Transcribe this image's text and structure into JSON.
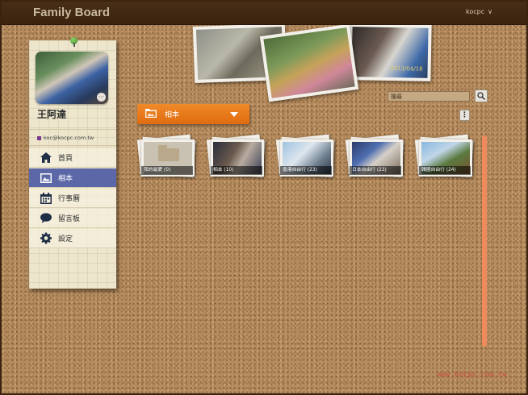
{
  "header": {
    "app_title": "Family Board",
    "username": "kocpc"
  },
  "collage": {
    "date_stamp": "2013/04/18"
  },
  "sidebar": {
    "profile_name": "王阿達",
    "profile_email": "koc@kocpc.com.tw",
    "nav_items": [
      {
        "label": "首頁",
        "icon": "home-icon"
      },
      {
        "label": "相本",
        "icon": "photo-icon",
        "active": true
      },
      {
        "label": "行事曆",
        "icon": "calendar-icon"
      },
      {
        "label": "留言板",
        "icon": "chat-bubble-icon"
      },
      {
        "label": "設定",
        "icon": "gear-icon"
      }
    ]
  },
  "main": {
    "album_dropdown_label": "相本",
    "search_placeholder": "搜尋",
    "albums": [
      {
        "caption": "我的最愛 (0)"
      },
      {
        "caption": "相本 (10)"
      },
      {
        "caption": "香港自由行 (23)"
      },
      {
        "caption": "日本自由行 (23)"
      },
      {
        "caption": "韓國自由行 (24)"
      }
    ]
  },
  "watermark": "www.kocpc.com.tw",
  "colors": {
    "header_bg": "#3a230f",
    "accent_orange": "#e97a1c",
    "nav_active": "#5c67a7",
    "cork": "#b48a5c"
  }
}
